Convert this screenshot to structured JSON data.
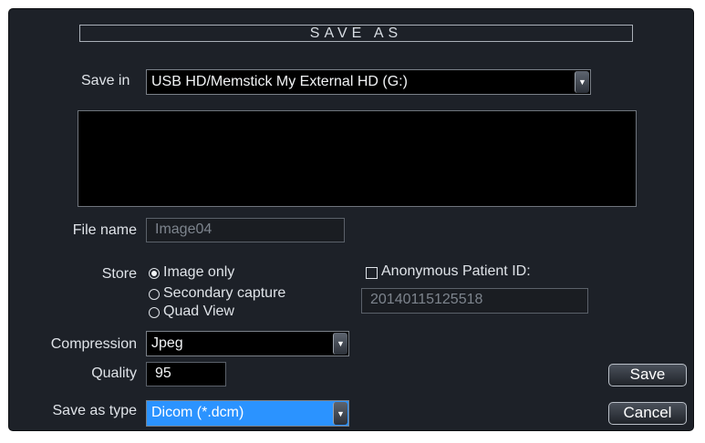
{
  "dialog": {
    "title": "SAVE AS",
    "save_in_label": "Save in",
    "save_in_value": "USB HD/Memstick  My External HD (G:)",
    "file_name_label": "File name",
    "file_name_value": "Image04",
    "store_label": "Store",
    "store_options": [
      "Image only",
      "Secondary capture",
      "Quad View"
    ],
    "store_selected": "Image only",
    "anonymous_label": "Anonymous Patient ID:",
    "anonymous_checked": false,
    "patient_id_value": "20140115125518",
    "compression_label": "Compression",
    "compression_value": "Jpeg",
    "quality_label": "Quality",
    "quality_value": "95",
    "save_as_type_label": "Save as type",
    "save_as_type_value": "Dicom  (*.dcm)",
    "save_button": "Save",
    "cancel_button": "Cancel"
  },
  "icons": {
    "dropdown": "chevron-down-icon",
    "radio": "radio-icon",
    "checkbox": "checkbox-icon"
  },
  "colors": {
    "dialog_bg": "#1d2128",
    "selection": "#2b93ff"
  }
}
